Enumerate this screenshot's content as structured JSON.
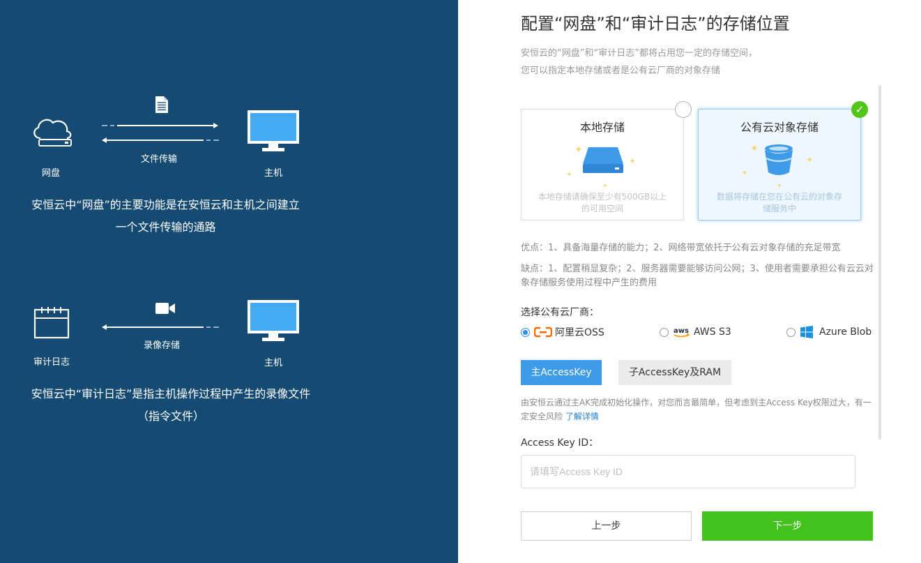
{
  "left": {
    "section1": {
      "file_icon": "document-icon",
      "transfer_label": "文件传输",
      "disk_label": "网盘",
      "host_label": "主机",
      "desc_line1": "安恒云中“网盘”的主要功能是在安恒云和主机之间建立",
      "desc_line2": "一个文件传输的通路"
    },
    "section2": {
      "video_icon": "video-camera-icon",
      "record_label": "录像存储",
      "audit_label": "审计日志",
      "host_label": "主机",
      "desc_line1": "安恒云中“审计日志”是指主机操作过程中产生的录像文件",
      "desc_line2": "（指令文件）"
    }
  },
  "right": {
    "title": "配置“网盘”和“审计日志”的存储位置",
    "subtitle_line1": "安恒云的“网盘”和“审计日志”都将占用您一定的存储空间，",
    "subtitle_line2": "您可以指定本地存储或者是公有云厂商的对象存储",
    "cards": [
      {
        "title": "本地存储",
        "desc": "本地存储请确保至少有500GB以上的可用空间",
        "selected": false,
        "icon": "hard-drive-icon"
      },
      {
        "title": "公有云对象存储",
        "desc": "数据将存储在您在公有云的对象存储服务中",
        "selected": true,
        "icon": "bucket-icon"
      }
    ],
    "pros": "优点：1、具备海量存储的能力；2、网络带宽依托于公有云对象存储的充足带宽",
    "cons": "缺点：1、配置稍显复杂；2、服务器需要能够访问公网；3、使用者需要承担公有云云对象存储服务使用过程中产生的费用",
    "provider_label": "选择公有云厂商：",
    "providers": [
      {
        "name": "阿里云OSS",
        "checked": true,
        "icon": "aliyun-icon",
        "color": "#ff6a00"
      },
      {
        "name": "AWS S3",
        "checked": false,
        "icon": "aws-icon",
        "color": "#ff9900"
      },
      {
        "name": "Azure Blob",
        "checked": false,
        "icon": "windows-icon",
        "color": "#1e90e0"
      }
    ],
    "tabs": [
      {
        "label": "主AccessKey",
        "active": true
      },
      {
        "label": "子AccessKey及RAM",
        "active": false
      }
    ],
    "note_text": "由安恒云通过主AK完成初始化操作，对您而言最简单，但考虑到主Access Key权限过大，有一定安全风险",
    "note_link": "了解详情",
    "field_label": "Access Key ID：",
    "field_placeholder": "请填写Access Key ID",
    "field_value": "",
    "prev_label": "上一步",
    "next_label": "下一步",
    "colors": {
      "left_bg": "#154a72",
      "accent_blue": "#3d9be9",
      "primary_green": "#43c21b",
      "check_green": "#52c41a"
    }
  }
}
